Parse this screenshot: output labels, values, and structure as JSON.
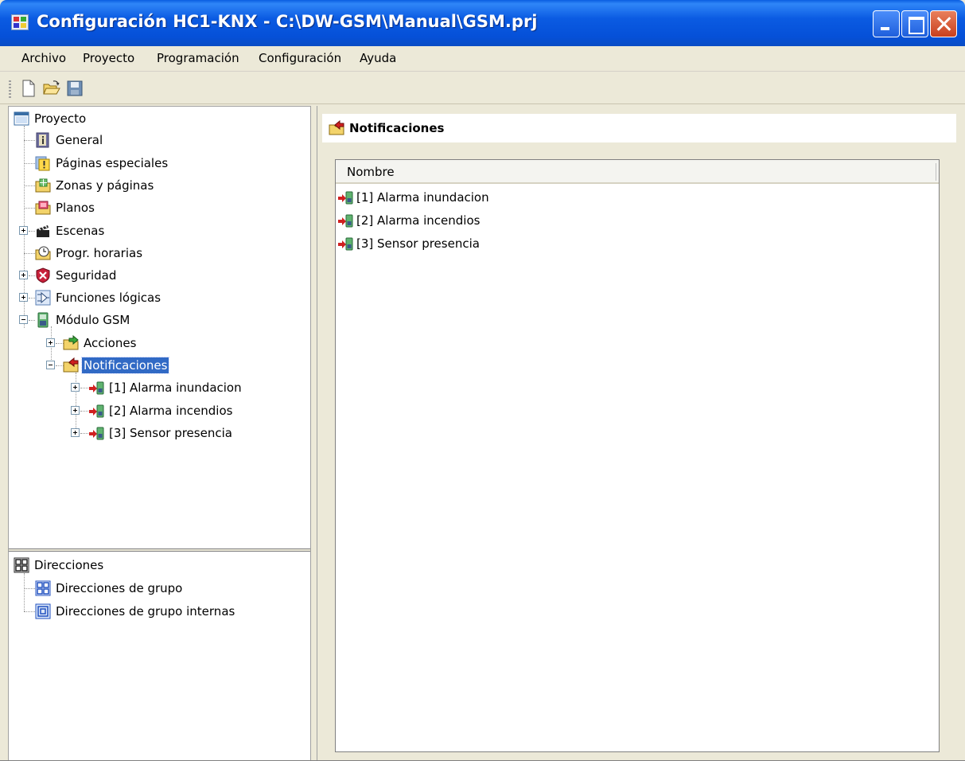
{
  "window": {
    "title": "Configuración HC1-KNX - C:\\DW-GSM\\Manual\\GSM.prj"
  },
  "menu": {
    "items": [
      "Archivo",
      "Proyecto",
      "Programación",
      "Configuración",
      "Ayuda"
    ]
  },
  "toolbar": {
    "buttons": [
      {
        "icon": "new-document-icon"
      },
      {
        "icon": "open-folder-icon"
      },
      {
        "icon": "save-disk-icon"
      }
    ]
  },
  "project_tree": {
    "root": "Proyecto",
    "items": {
      "general": "General",
      "special_pages": "Páginas especiales",
      "zones": "Zonas y páginas",
      "plans": "Planos",
      "scenes": "Escenas",
      "schedules": "Progr. horarias",
      "security": "Seguridad",
      "logic": "Funciones lógicas",
      "gsm": "Módulo GSM",
      "actions": "Acciones",
      "notifications": "Notificaciones",
      "notif_1": "[1] Alarma inundacion",
      "notif_2": "[2] Alarma incendios",
      "notif_3": "[3] Sensor presencia"
    }
  },
  "address_tree": {
    "root": "Direcciones",
    "items": {
      "group": "Direcciones de grupo",
      "internal": "Direcciones de grupo internas"
    }
  },
  "details": {
    "header": "Notificaciones",
    "column": "Nombre",
    "rows": [
      "[1] Alarma inundacion",
      "[2] Alarma incendios",
      "[3] Sensor presencia"
    ]
  },
  "colors": {
    "titlebar": "#0a5ee0",
    "selection": "#316ac5",
    "face": "#ece9d8"
  }
}
